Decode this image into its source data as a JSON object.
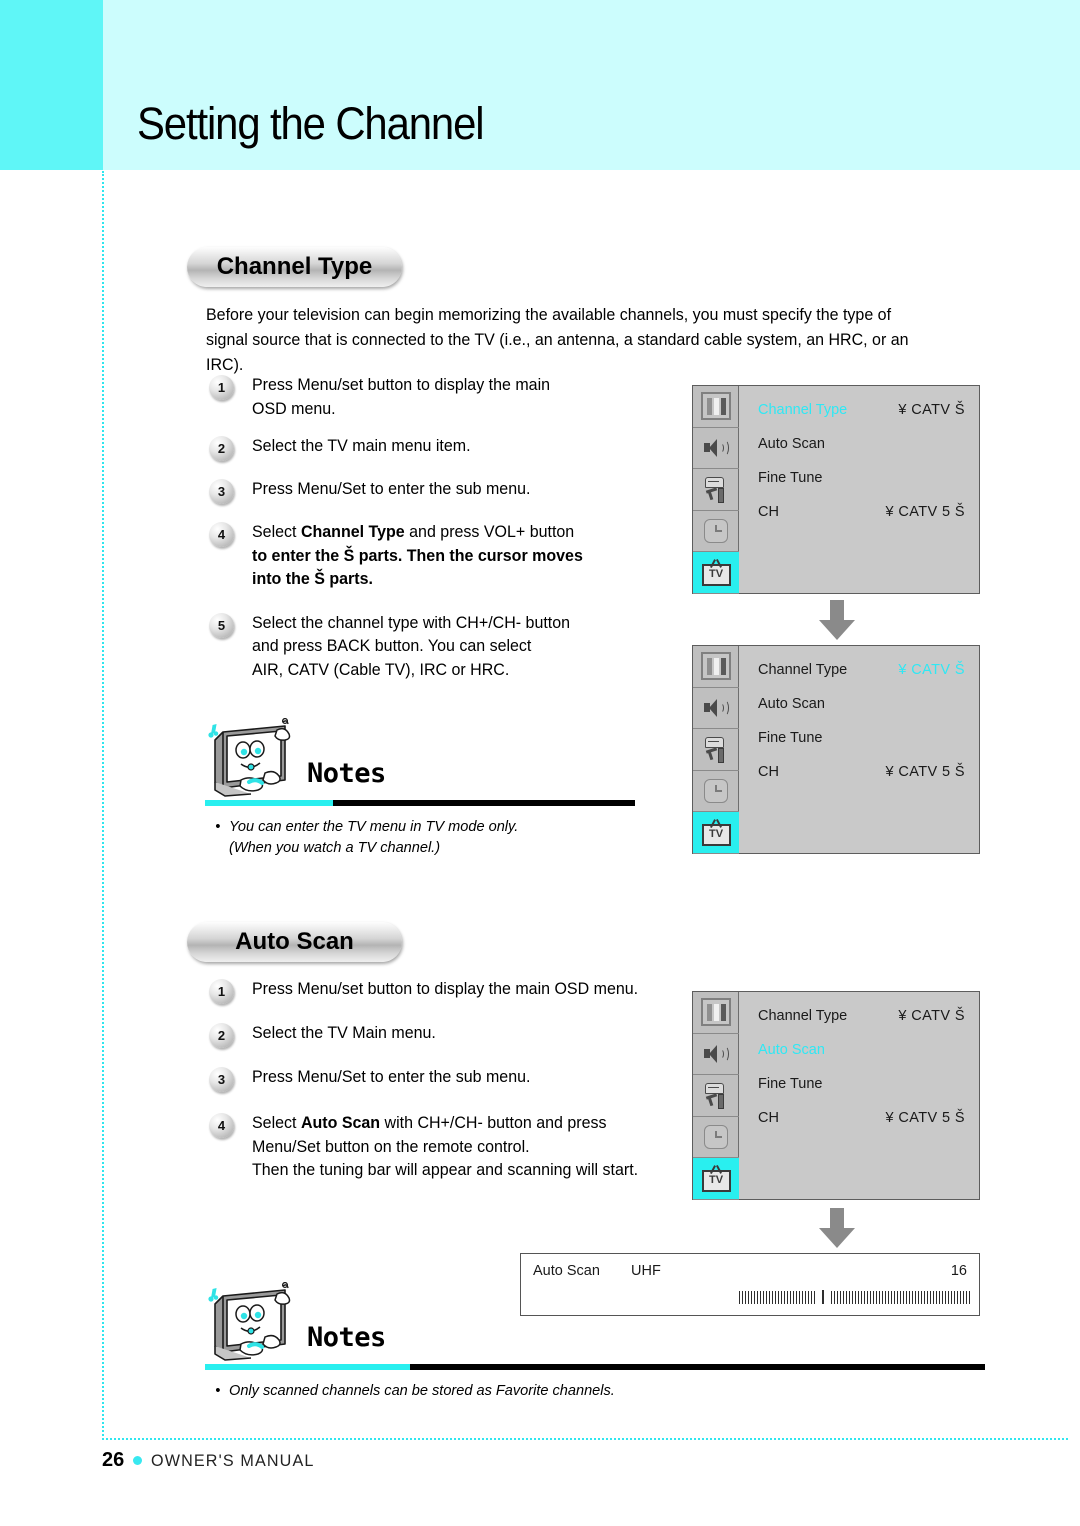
{
  "header": {
    "title": "Setting the Channel"
  },
  "sections": {
    "channel_type": {
      "pill_label": "Channel Type",
      "intro": "Before your television can begin memorizing the available channels, you must specify the type of signal source that is connected to the TV (i.e., an antenna, a standard cable system, an HRC, or an IRC).",
      "steps": [
        {
          "num": "1",
          "line1": "Press Menu/set button to display the main",
          "line2": "OSD menu."
        },
        {
          "num": "2",
          "line1": "Select the TV main menu item.",
          "line2": ""
        },
        {
          "num": "3",
          "line1": "Press Menu/Set to enter the sub menu.",
          "line2": ""
        },
        {
          "num": "4",
          "line1": "Select ",
          "bold": "Channel Type",
          "line1b": " and press VOL+ button",
          "line2": "to enter the Š      parts. Then the cursor moves",
          "line3": "into the Š      parts."
        },
        {
          "num": "5",
          "line1": "Select the channel type with CH+/CH- button",
          "line2": "and press BACK button. You can select",
          "line3": "AIR, CATV (Cable TV), IRC or HRC."
        }
      ],
      "notes": {
        "word": "Notes",
        "bullet": "•",
        "line1": "You can enter the TV menu in TV mode only.",
        "line2": "(When you watch a TV channel.)"
      }
    },
    "auto_scan": {
      "pill_label": "Auto Scan",
      "steps": [
        {
          "num": "1",
          "line1": "Press Menu/set button to display the main OSD menu.",
          "line2": ""
        },
        {
          "num": "2",
          "line1": "Select the TV Main menu.",
          "line2": ""
        },
        {
          "num": "3",
          "line1": "Press Menu/Set to enter the sub menu.",
          "line2": ""
        },
        {
          "num": "4",
          "line1": "Select ",
          "bold": "Auto Scan",
          "line1b": " with CH+/CH- button and press",
          "line2": "Menu/Set button on the remote control.",
          "line3": "Then the tuning bar will appear and  scanning will start."
        }
      ],
      "notes": {
        "word": "Notes",
        "bullet": "•",
        "line1": "Only scanned channels can be stored as Favorite channels.",
        "line2": ""
      }
    }
  },
  "osd_rail": {
    "icons": [
      {
        "name": "picture-icon",
        "active": false
      },
      {
        "name": "audio-icon",
        "active": false
      },
      {
        "name": "setup-icon",
        "active": false
      },
      {
        "name": "clock-icon",
        "active": false
      },
      {
        "name": "tv-icon",
        "active": true,
        "label": "TV"
      }
    ]
  },
  "osd_panels": [
    {
      "id": "osd-1",
      "rows": [
        {
          "label": "Channel Type",
          "value": "¥ CATV Š",
          "label_highlighted": true,
          "value_highlighted": false
        },
        {
          "label": "Auto Scan",
          "value": "",
          "label_highlighted": false,
          "value_highlighted": false
        },
        {
          "label": "Fine Tune",
          "value": "",
          "label_highlighted": false,
          "value_highlighted": false
        },
        {
          "label": "CH",
          "value": "¥ CATV 5 Š",
          "label_highlighted": false,
          "value_highlighted": false
        }
      ]
    },
    {
      "id": "osd-2",
      "rows": [
        {
          "label": "Channel Type",
          "value": "¥ CATV Š",
          "label_highlighted": false,
          "value_highlighted": true
        },
        {
          "label": "Auto Scan",
          "value": "",
          "label_highlighted": false,
          "value_highlighted": false
        },
        {
          "label": "Fine Tune",
          "value": "",
          "label_highlighted": false,
          "value_highlighted": false
        },
        {
          "label": "CH",
          "value": "¥ CATV 5 Š",
          "label_highlighted": false,
          "value_highlighted": false
        }
      ]
    },
    {
      "id": "osd-3",
      "rows": [
        {
          "label": "Channel Type",
          "value": "¥ CATV Š",
          "label_highlighted": false,
          "value_highlighted": false
        },
        {
          "label": "Auto Scan",
          "value": "",
          "label_highlighted": true,
          "value_highlighted": false
        },
        {
          "label": "Fine Tune",
          "value": "",
          "label_highlighted": false,
          "value_highlighted": false
        },
        {
          "label": "CH",
          "value": "¥ CATV 5 Š",
          "label_highlighted": false,
          "value_highlighted": false
        }
      ]
    }
  ],
  "tuning_bar": {
    "label": "Auto Scan",
    "band": "UHF",
    "channel": "16"
  },
  "footer": {
    "page_number": "26",
    "label": "OWNER'S MANUAL"
  },
  "colors": {
    "header_band": "#ccfdfd",
    "header_tab": "#5ff6f7",
    "accent_cyan": "#29efef",
    "osd_background": "#c9c9c9",
    "osd_highlight": "#2fe8f4"
  }
}
